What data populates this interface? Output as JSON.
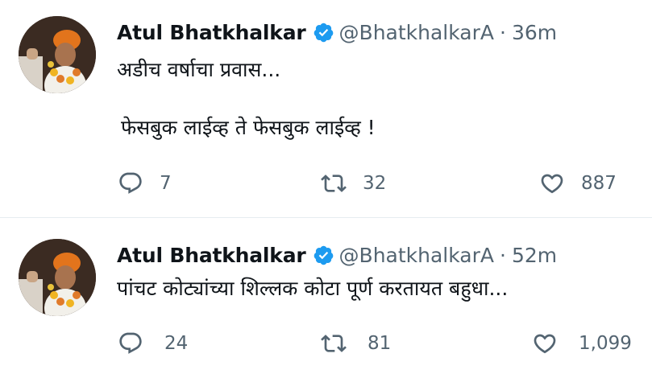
{
  "tweets": [
    {
      "author_name": "Atul Bhatkhalkar",
      "handle": "@BhatkhalkarA",
      "separator": "·",
      "time": "36m",
      "text_lines": [
        "अडीच वर्षाचा प्रवास...",
        "फेसबुक लाईव्ह ते फेसबुक लाईव्ह !"
      ],
      "replies": "7",
      "retweets": "32",
      "likes": "887"
    },
    {
      "author_name": "Atul Bhatkhalkar",
      "handle": "@BhatkhalkarA",
      "separator": "·",
      "time": "52m",
      "text_lines": [
        "पांचट कोट्यांच्या शिल्लक कोटा पूर्ण करतायत बहुधा..."
      ],
      "replies": "24",
      "retweets": "81",
      "likes": "1,099"
    }
  ],
  "icons": {
    "verified": "verified-badge-icon",
    "reply": "reply-icon",
    "retweet": "retweet-icon",
    "like": "heart-icon"
  },
  "colors": {
    "verified": "#1d9bf0",
    "secondary_text": "#536471",
    "primary_text": "#0f1419",
    "divider": "#e6ecf0"
  }
}
